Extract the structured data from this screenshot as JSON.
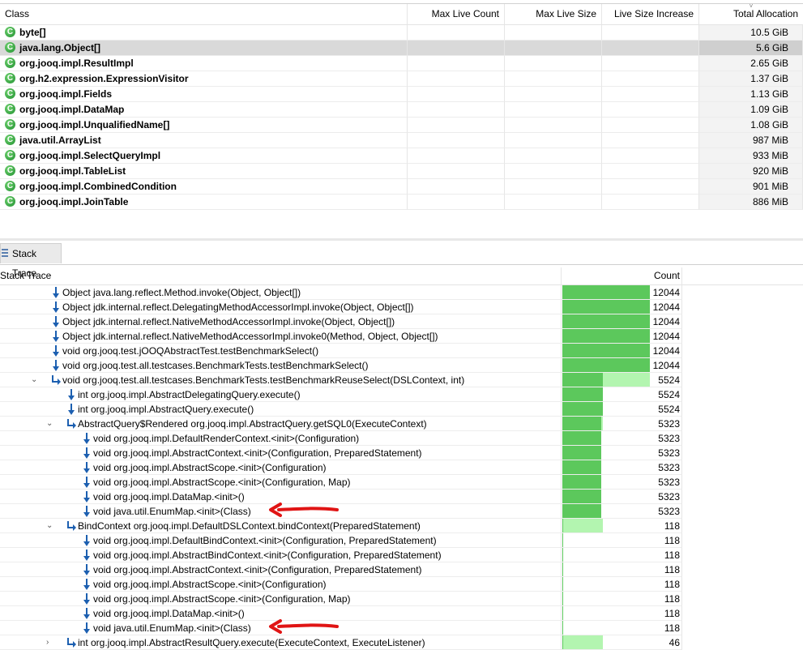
{
  "class_table": {
    "columns": [
      "Class",
      "Max Live Count",
      "Max Live Size",
      "Live Size Increase",
      "Total Allocation"
    ],
    "sort_indicator": "˅",
    "rows": [
      {
        "name": "byte[]",
        "total": "10.5 GiB"
      },
      {
        "name": "java.lang.Object[]",
        "total": "5.6 GiB",
        "selected": true
      },
      {
        "name": "org.jooq.impl.ResultImpl",
        "total": "2.65 GiB"
      },
      {
        "name": "org.h2.expression.ExpressionVisitor",
        "total": "1.37 GiB"
      },
      {
        "name": "org.jooq.impl.Fields",
        "total": "1.13 GiB"
      },
      {
        "name": "org.jooq.impl.DataMap",
        "total": "1.09 GiB"
      },
      {
        "name": "org.jooq.impl.UnqualifiedName[]",
        "total": "1.08 GiB"
      },
      {
        "name": "java.util.ArrayList",
        "total": "987 MiB"
      },
      {
        "name": "org.jooq.impl.SelectQueryImpl",
        "total": "933 MiB"
      },
      {
        "name": "org.jooq.impl.TableList",
        "total": "920 MiB"
      },
      {
        "name": "org.jooq.impl.CombinedCondition",
        "total": "901 MiB"
      },
      {
        "name": "org.jooq.impl.JoinTable",
        "total": "886 MiB"
      }
    ]
  },
  "tab": {
    "label": "Stack Trace"
  },
  "stack_trace": {
    "columns": [
      "Stack Trace",
      "Count"
    ],
    "max_count": 12044,
    "rows": [
      {
        "text": "Object java.lang.reflect.Method.invoke(Object, Object[])",
        "count": "12044",
        "depth": 0,
        "icon": "down"
      },
      {
        "text": "Object jdk.internal.reflect.DelegatingMethodAccessorImpl.invoke(Object, Object[])",
        "count": "12044",
        "depth": 0,
        "icon": "down"
      },
      {
        "text": "Object jdk.internal.reflect.NativeMethodAccessorImpl.invoke(Object, Object[])",
        "count": "12044",
        "depth": 0,
        "icon": "down"
      },
      {
        "text": "Object jdk.internal.reflect.NativeMethodAccessorImpl.invoke0(Method, Object, Object[])",
        "count": "12044",
        "depth": 0,
        "icon": "down"
      },
      {
        "text": "void org.jooq.test.jOOQAbstractTest.testBenchmarkSelect()",
        "count": "12044",
        "depth": 0,
        "icon": "down"
      },
      {
        "text": "void org.jooq.test.all.testcases.BenchmarkTests.testBenchmarkSelect()",
        "count": "12044",
        "depth": 0,
        "icon": "down"
      },
      {
        "text": "void org.jooq.test.all.testcases.BenchmarkTests.testBenchmarkReuseSelect(DSLContext, int)",
        "count": "5524",
        "depth": 0,
        "icon": "bend",
        "expanded": true
      },
      {
        "text": "int org.jooq.impl.AbstractDelegatingQuery.execute()",
        "count": "5524",
        "depth": 1,
        "icon": "down"
      },
      {
        "text": "int org.jooq.impl.AbstractQuery.execute()",
        "count": "5524",
        "depth": 1,
        "icon": "down"
      },
      {
        "text": "AbstractQuery$Rendered org.jooq.impl.AbstractQuery.getSQL0(ExecuteContext)",
        "count": "5323",
        "depth": 1,
        "icon": "bend",
        "expanded": true
      },
      {
        "text": "void org.jooq.impl.DefaultRenderContext.<init>(Configuration)",
        "count": "5323",
        "depth": 2,
        "icon": "down"
      },
      {
        "text": "void org.jooq.impl.AbstractContext.<init>(Configuration, PreparedStatement)",
        "count": "5323",
        "depth": 2,
        "icon": "down"
      },
      {
        "text": "void org.jooq.impl.AbstractScope.<init>(Configuration)",
        "count": "5323",
        "depth": 2,
        "icon": "down"
      },
      {
        "text": "void org.jooq.impl.AbstractScope.<init>(Configuration, Map)",
        "count": "5323",
        "depth": 2,
        "icon": "down"
      },
      {
        "text": "void org.jooq.impl.DataMap.<init>()",
        "count": "5323",
        "depth": 2,
        "icon": "down"
      },
      {
        "text": "void java.util.EnumMap.<init>(Class)",
        "count": "5323",
        "depth": 2,
        "icon": "down",
        "callout": true
      },
      {
        "text": "BindContext org.jooq.impl.DefaultDSLContext.bindContext(PreparedStatement)",
        "count": "118",
        "depth": 1,
        "icon": "bend",
        "expanded": true
      },
      {
        "text": "void org.jooq.impl.DefaultBindContext.<init>(Configuration, PreparedStatement)",
        "count": "118",
        "depth": 2,
        "icon": "down"
      },
      {
        "text": "void org.jooq.impl.AbstractBindContext.<init>(Configuration, PreparedStatement)",
        "count": "118",
        "depth": 2,
        "icon": "down"
      },
      {
        "text": "void org.jooq.impl.AbstractContext.<init>(Configuration, PreparedStatement)",
        "count": "118",
        "depth": 2,
        "icon": "down"
      },
      {
        "text": "void org.jooq.impl.AbstractScope.<init>(Configuration)",
        "count": "118",
        "depth": 2,
        "icon": "down"
      },
      {
        "text": "void org.jooq.impl.AbstractScope.<init>(Configuration, Map)",
        "count": "118",
        "depth": 2,
        "icon": "down"
      },
      {
        "text": "void org.jooq.impl.DataMap.<init>()",
        "count": "118",
        "depth": 2,
        "icon": "down"
      },
      {
        "text": "void java.util.EnumMap.<init>(Class)",
        "count": "118",
        "depth": 2,
        "icon": "down",
        "callout": true
      },
      {
        "text": "int org.jooq.impl.AbstractResultQuery.execute(ExecuteContext, ExecuteListener)",
        "count": "46",
        "depth": 1,
        "icon": "bend",
        "expanded": false
      }
    ]
  },
  "colors": {
    "bar_dark": "#5cc85c",
    "bar_light": "#b3f5b0",
    "icon_blue": "#1c5fb0",
    "callout_red": "#e01414"
  }
}
